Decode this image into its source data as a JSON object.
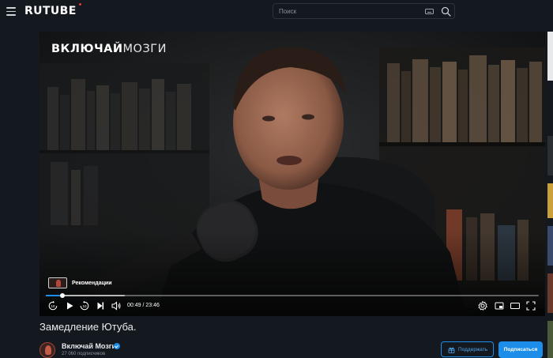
{
  "header": {
    "logo": "RUTUBE",
    "search_placeholder": "Поиск"
  },
  "player": {
    "watermark_bold": "ВКЛЮЧАЙ",
    "watermark_light": "МОЗГИ",
    "recommendations_label": "Рекомендации",
    "time_current": "00:49",
    "time_separator": " / ",
    "time_total": "23:46",
    "progress_fraction": 0.034,
    "buffer_fraction": 0.16,
    "rewind_label": "10",
    "forward_label": "10"
  },
  "video": {
    "title": "Замедление Ютуба."
  },
  "channel": {
    "name": "Включай Мозги",
    "subscribers": "27 060 подписчиков",
    "verified": true
  },
  "actions": {
    "support_label": "Поддержать",
    "subscribe_label": "Подписаться"
  },
  "colors": {
    "accent": "#1c8eea",
    "background": "#14191f"
  }
}
